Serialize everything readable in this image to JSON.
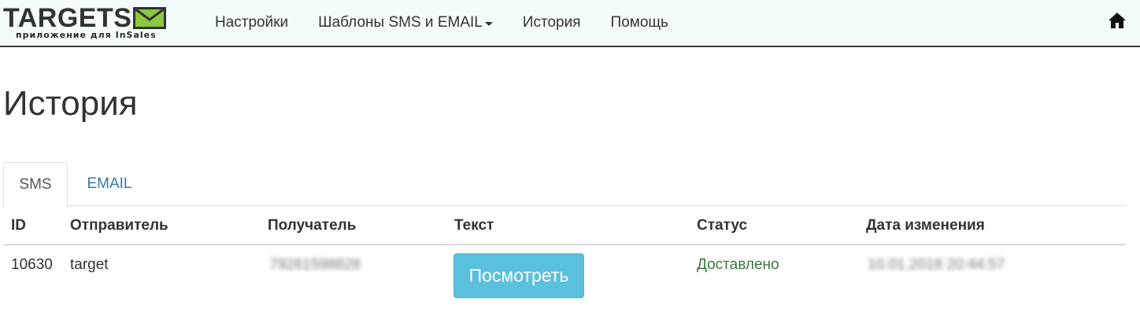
{
  "brand": {
    "name": "TARGETS",
    "subtitle": "приложение для InSales",
    "logo_icon": "envelope-icon",
    "accent_green": "#8dc63f"
  },
  "nav": {
    "items": [
      {
        "label": "Настройки"
      },
      {
        "label": "Шаблоны SMS и EMAIL",
        "has_dropdown": true
      },
      {
        "label": "История"
      },
      {
        "label": "Помощь"
      }
    ],
    "home_icon": "home-icon"
  },
  "page": {
    "title": "История"
  },
  "tabs": {
    "items": [
      {
        "label": "SMS",
        "active": true
      },
      {
        "label": "EMAIL",
        "active": false
      }
    ]
  },
  "table": {
    "columns": [
      "ID",
      "Отправитель",
      "Получатель",
      "Текст",
      "Статус",
      "Дата изменения"
    ],
    "rows": [
      {
        "id": "10630",
        "sender": "target",
        "recipient": "79261598828",
        "text_button": "Посмотреть",
        "status": "Доставлено",
        "changed_at": "10.01.2018 20:44:57"
      }
    ]
  },
  "colors": {
    "link": "#337ab7",
    "info_button": "#5bc0de",
    "success_text": "#3c763d",
    "navbar_bg": "#f4fbfd"
  }
}
